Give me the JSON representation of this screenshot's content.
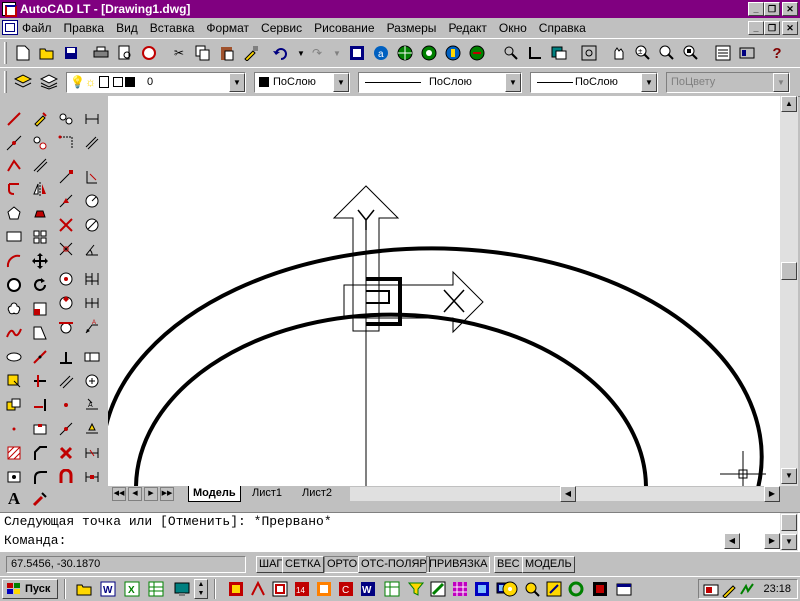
{
  "window": {
    "title": "AutoCAD LT - [Drawing1.dwg]",
    "controls": [
      "_",
      "❐",
      "✕"
    ],
    "doc_controls": [
      "_",
      "❐",
      "✕"
    ]
  },
  "menu": {
    "items": [
      "Файл",
      "Правка",
      "Вид",
      "Вставка",
      "Формат",
      "Сервис",
      "Рисование",
      "Размеры",
      "Редакт",
      "Окно",
      "Справка"
    ]
  },
  "properties_toolbar": {
    "layer_value": "0",
    "color_value": "ПоСлою",
    "linetype_value": "ПоСлою",
    "lineweight_value": "ПоСлою",
    "plotstyle_value": "ПоЦвету"
  },
  "layout_tabs": {
    "tabs": [
      "Модель",
      "Лист1",
      "Лист2"
    ],
    "active": "Модель"
  },
  "command": {
    "history_line": "Следующая точка или [Отменить]: *Прервано*",
    "prompt": "Команда:"
  },
  "status": {
    "coordinates": "67.5456,  -30.1870",
    "toggles": [
      "ШАГ",
      "СЕТКА",
      "ОРТО",
      "ОТС-ПОЛЯР",
      "ПРИВЯЗКА",
      "ВЕС",
      "МОДЕЛЬ"
    ]
  },
  "taskbar": {
    "start_label": "Пуск",
    "clock": "23:18"
  },
  "colors": {
    "titlebar": "#800080",
    "window_bg": "#c0c0c0",
    "canvas": "#ffffff"
  }
}
